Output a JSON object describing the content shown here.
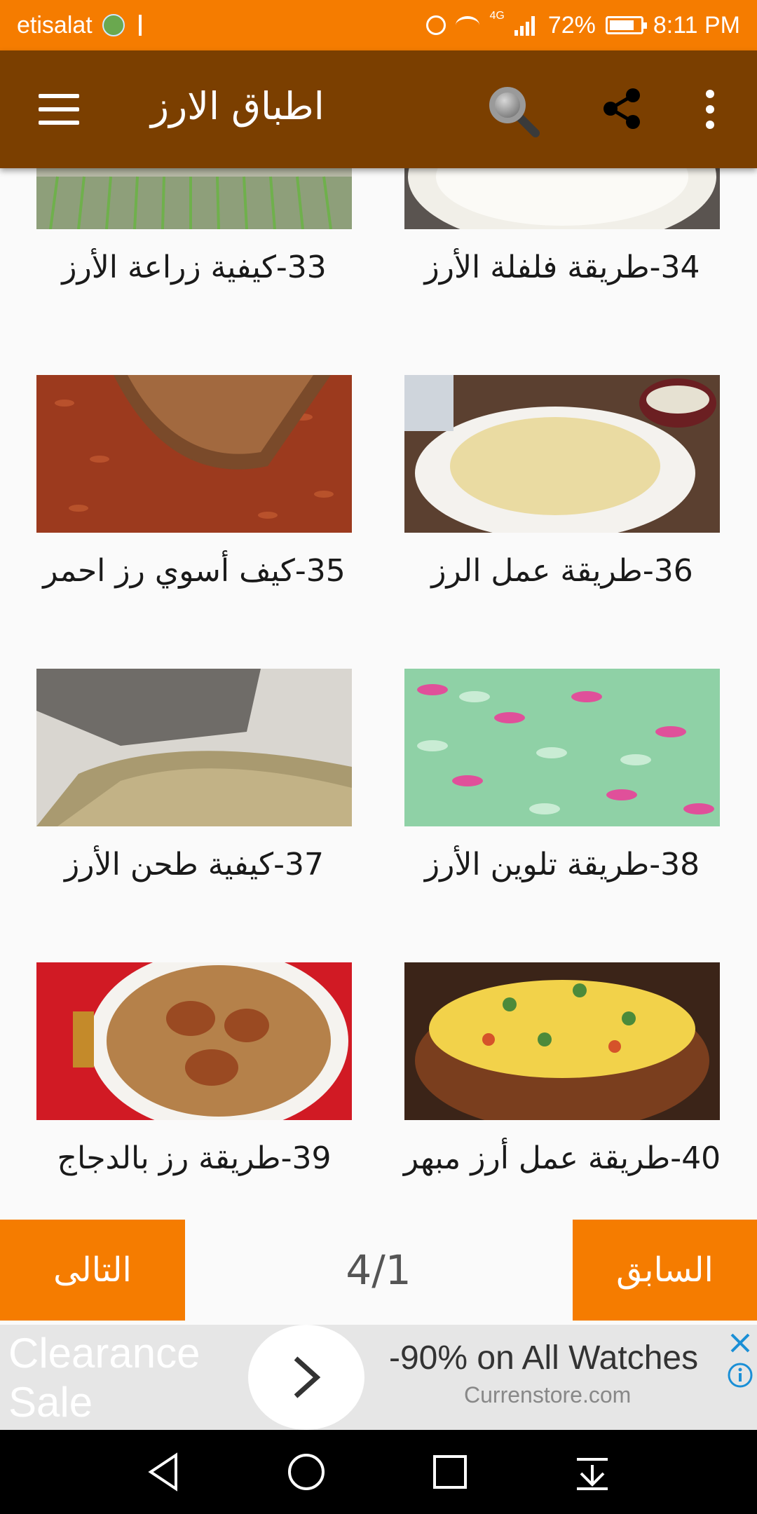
{
  "status_bar": {
    "carrier": "etisalat",
    "network": "4G",
    "battery": "72%",
    "time": "8:11 PM"
  },
  "app_bar": {
    "title": "اطباق الارز",
    "icons": [
      "menu-icon",
      "search-icon",
      "share-icon",
      "more-vert-icon"
    ]
  },
  "grid": {
    "items": [
      {
        "title": "33-كيفية زراعة الأرز",
        "image": "rice-field-seedlings"
      },
      {
        "title": "34-طريقة فلفلة الأرز",
        "image": "white-rice-pot"
      },
      {
        "title": "35-كيف أسوي رز احمر",
        "image": "red-rice-grains"
      },
      {
        "title": "36-طريقة عمل الرز",
        "image": "fried-rice-plate"
      },
      {
        "title": "37-كيفية طحن الأرز",
        "image": "rice-milling"
      },
      {
        "title": "38-طريقة تلوين الأرز",
        "image": "colored-rice-grains"
      },
      {
        "title": "39-طريقة رز بالدجاج",
        "image": "chicken-rice-plate"
      },
      {
        "title": "40-طريقة عمل أرز مبهر",
        "image": "spiced-rice-pot"
      }
    ]
  },
  "pager": {
    "next_label": "التالى",
    "prev_label": "السابق",
    "page": "4/1"
  },
  "ad": {
    "left_text_line1": "Clearance",
    "left_text_line2": "Sale",
    "headline": "-90% on All Watches",
    "domain": "Currenstore.com"
  },
  "colors": {
    "status_bar": "#f57c00",
    "app_bar": "#7b3f00",
    "buttons": "#f57c00"
  }
}
